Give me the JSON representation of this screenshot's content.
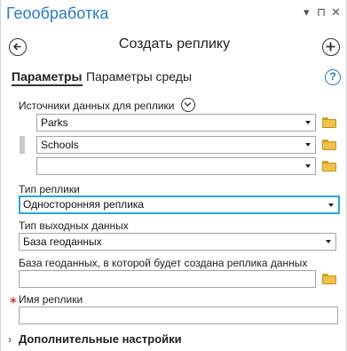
{
  "window": {
    "title": "Геообработка",
    "pin_glyph": "▾",
    "float_glyph": "⊓",
    "close_glyph": "✕"
  },
  "header": {
    "heading": "Создать реплику"
  },
  "tabs": [
    {
      "label": "Параметры",
      "active": true
    },
    {
      "label": "Параметры среды",
      "active": false
    }
  ],
  "help_glyph": "?",
  "form": {
    "sources_label": "Источники данных для реплики",
    "sources": [
      "Parks",
      "Schools",
      ""
    ],
    "replica_type_label": "Тип реплики",
    "replica_type_value": "Односторонняя реплика",
    "output_type_label": "Тип выходных данных",
    "output_type_value": "База геоданных",
    "geodatabase_label": "База геоданных, в которой будет создана реплика данных",
    "geodatabase_value": "",
    "replica_name_label": "Имя реплики",
    "replica_name_value": "",
    "required_marker": "✶"
  },
  "more_settings": {
    "caret": "›",
    "label": "Дополнительные настройки"
  },
  "colors": {
    "title_blue": "#2a7bc3",
    "focus_border": "#2aa6dc",
    "required_red": "#d6403a",
    "folder_yellow": "#efc04b"
  }
}
